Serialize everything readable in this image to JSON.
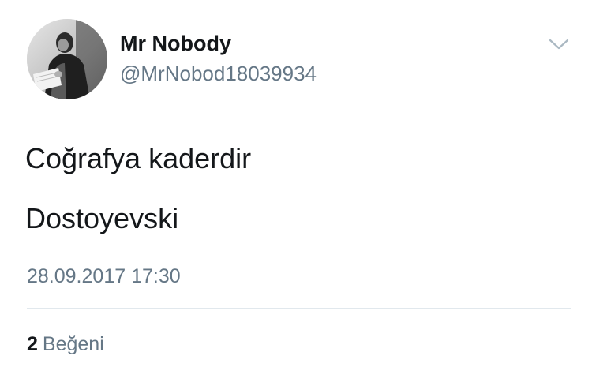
{
  "tweet": {
    "author": {
      "display_name": "Mr Nobody",
      "handle": "@MrNobod18039934"
    },
    "text_lines": [
      "Coğrafya kaderdir",
      "Dostoyevski"
    ],
    "timestamp": "28.09.2017 17:30",
    "likes": {
      "count": "2",
      "label": "Beğeni"
    },
    "menu_icon": "chevron-down-icon",
    "colors": {
      "primary_text": "#14171a",
      "secondary_text": "#657786",
      "divider": "#e1e8ed"
    }
  }
}
